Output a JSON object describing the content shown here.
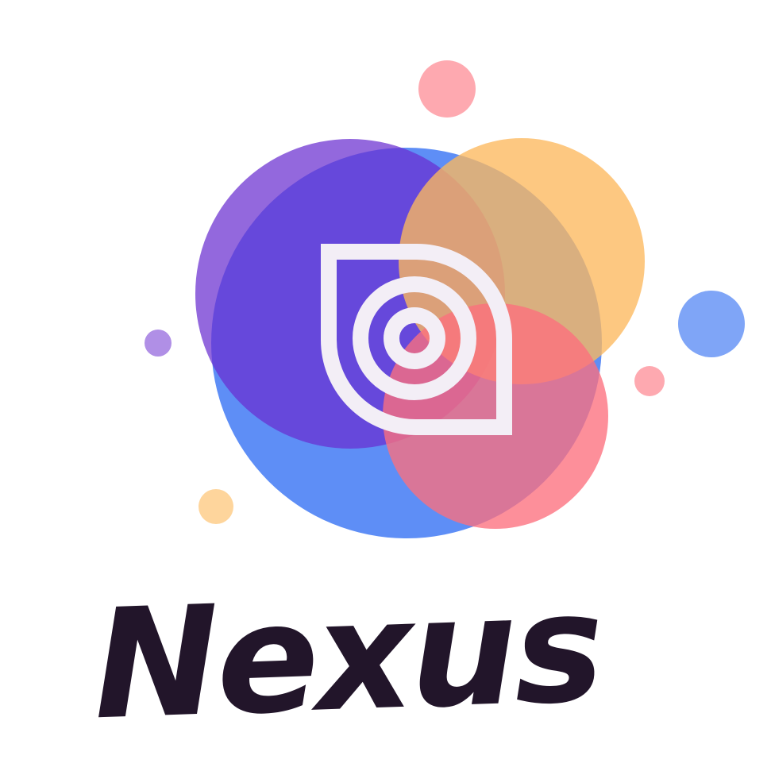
{
  "logo": {
    "brand_name": "Nexus",
    "icon": "concentric-target-in-rounded-square-icon",
    "colors": {
      "blue": "#5e8ef6",
      "purple": "#8451d8",
      "orange": "#fdb95e",
      "pink": "#fd7784",
      "icon_fill": "#f3eef6",
      "text": "#22152a"
    }
  }
}
